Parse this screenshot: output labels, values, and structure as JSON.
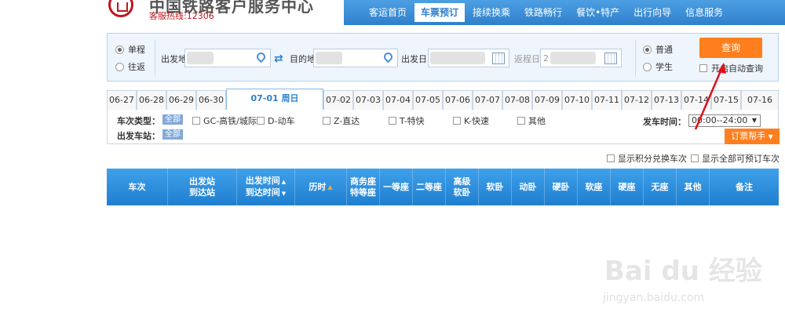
{
  "header": {
    "title": "中国铁路客户服务中心",
    "hotline": "客服热线:12306",
    "nav": [
      "客运首页",
      "车票预订",
      "接续换乘",
      "铁路畅行",
      "餐饮•特产",
      "出行向导",
      "信息服务"
    ],
    "nav_active": "车票预订"
  },
  "search": {
    "trip_types": [
      "单程",
      "往返"
    ],
    "from_label": "出发地",
    "to_label": "目的地",
    "depart_label": "出发日",
    "return_label": "返程日",
    "return_value": "2",
    "passenger_types": [
      "普通",
      "学生"
    ],
    "query_label": "查询",
    "auto_query_label": "开启自动查询"
  },
  "dates": {
    "before": [
      "06-27",
      "06-28",
      "06-29",
      "06-30"
    ],
    "active": "07-01 周日",
    "after": [
      "07-02",
      "07-03",
      "07-04",
      "07-05",
      "07-06",
      "07-07",
      "07-08",
      "07-09",
      "07-10",
      "07-11",
      "07-12",
      "07-13",
      "07-14",
      "07-15",
      "07-16"
    ]
  },
  "filters": {
    "train_type_label": "车次类型：",
    "all_label": "全部",
    "train_types": [
      "GC-高铁/城际",
      "D-动车",
      "Z-直达",
      "T-特快",
      "K-快速",
      "其他"
    ],
    "depart_station_label": "出发车站：",
    "depart_time_label": "发车时间：",
    "depart_time_value": "00:00--24:00",
    "helper_label": "订票帮手"
  },
  "extra": {
    "points_label": "显示积分兑换车次",
    "all_bookable_label": "显示全部可预订车次"
  },
  "table": {
    "train_no": "车次",
    "station_top": "出发站",
    "station_bottom": "到达站",
    "time_top": "出发时间",
    "time_bottom": "到达时间",
    "duration": "历时",
    "business_top": "商务座",
    "business_bottom": "特等座",
    "first_class": "一等座",
    "second_class": "二等座",
    "deluxe_top": "高级",
    "deluxe_bottom": "软卧",
    "soft_sleeper": "软卧",
    "motor_sleeper": "动卧",
    "hard_sleeper": "硬卧",
    "soft_seat": "软座",
    "hard_seat": "硬座",
    "no_seat": "无座",
    "other": "其他",
    "remarks": "备注"
  },
  "watermark": {
    "brand": "Bai du 经验",
    "url": "jingyan.baidu.com"
  }
}
